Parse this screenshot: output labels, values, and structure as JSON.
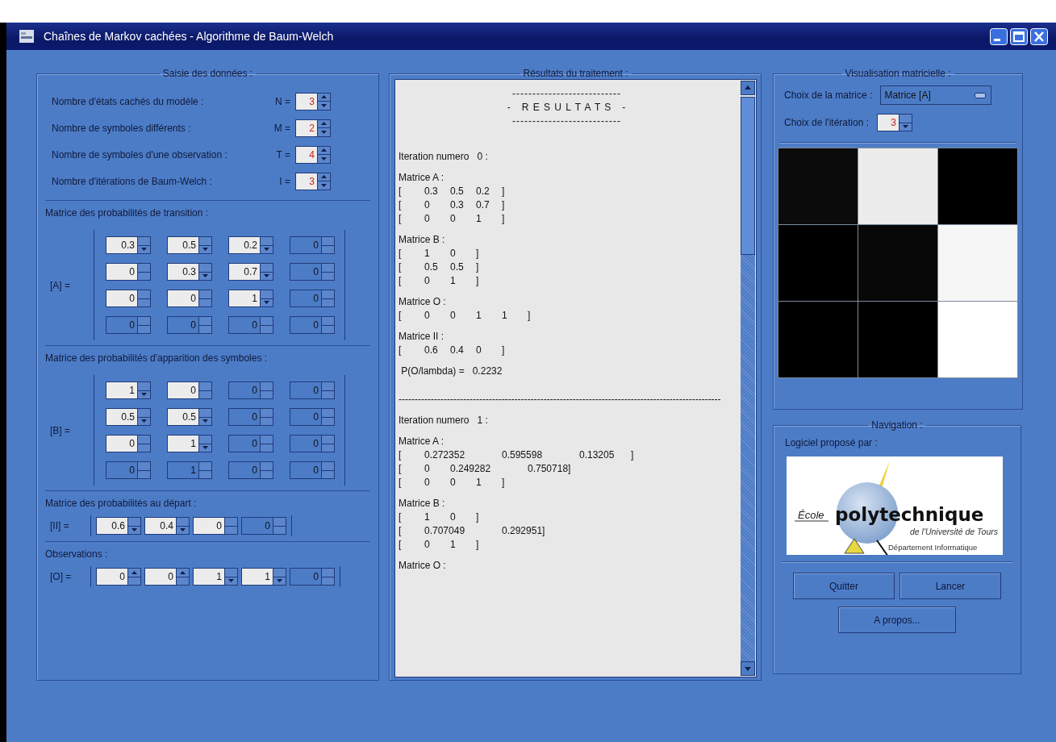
{
  "window": {
    "title": "Chaînes de Markov cachées - Algorithme de Baum-Welch"
  },
  "input_panel": {
    "title": "Saisie des données :",
    "params": [
      {
        "label": "Nombre d'états cachés du modèle :",
        "symbol": "N =",
        "value": "3",
        "disabled": false,
        "up_arrow": true,
        "down_arrow": true
      },
      {
        "label": "Nombre de symboles différents :",
        "symbol": "M =",
        "value": "2",
        "disabled": false,
        "up_arrow": true,
        "down_arrow": true
      },
      {
        "label": "Nombre de symboles d'une observation :",
        "symbol": "T =",
        "value": "4",
        "disabled": false,
        "up_arrow": true,
        "down_arrow": true
      },
      {
        "label": "Nombre d'itérations de Baum-Welch :",
        "symbol": "I =",
        "value": "3",
        "disabled": false,
        "up_arrow": true,
        "down_arrow": true
      }
    ],
    "matrices": [
      {
        "title": "Matrice des probabilités de transition :",
        "symbol": "[A] =",
        "rows": [
          [
            {
              "value": "0.3",
              "disabled": false,
              "up_arrow": false,
              "down_arrow": true
            },
            {
              "value": "0.5",
              "disabled": false,
              "up_arrow": false,
              "down_arrow": true
            },
            {
              "value": "0.2",
              "disabled": false,
              "up_arrow": false,
              "down_arrow": true
            },
            {
              "value": "0",
              "disabled": true,
              "up_arrow": false,
              "down_arrow": false
            }
          ],
          [
            {
              "value": "0",
              "disabled": false,
              "up_arrow": false,
              "down_arrow": false
            },
            {
              "value": "0.3",
              "disabled": false,
              "up_arrow": false,
              "down_arrow": true
            },
            {
              "value": "0.7",
              "disabled": false,
              "up_arrow": false,
              "down_arrow": true
            },
            {
              "value": "0",
              "disabled": true,
              "up_arrow": false,
              "down_arrow": false
            }
          ],
          [
            {
              "value": "0",
              "disabled": false,
              "up_arrow": false,
              "down_arrow": false
            },
            {
              "value": "0",
              "disabled": false,
              "up_arrow": false,
              "down_arrow": false
            },
            {
              "value": "1",
              "disabled": false,
              "up_arrow": false,
              "down_arrow": true
            },
            {
              "value": "0",
              "disabled": true,
              "up_arrow": false,
              "down_arrow": false
            }
          ],
          [
            {
              "value": "0",
              "disabled": true,
              "up_arrow": false,
              "down_arrow": false
            },
            {
              "value": "0",
              "disabled": true,
              "up_arrow": false,
              "down_arrow": false
            },
            {
              "value": "0",
              "disabled": true,
              "up_arrow": false,
              "down_arrow": false
            },
            {
              "value": "0",
              "disabled": true,
              "up_arrow": false,
              "down_arrow": false
            }
          ]
        ]
      },
      {
        "title": "Matrice des probabilités d'apparition des symboles :",
        "symbol": "[B] =",
        "rows": [
          [
            {
              "value": "1",
              "disabled": false,
              "up_arrow": false,
              "down_arrow": true
            },
            {
              "value": "0",
              "disabled": false,
              "up_arrow": false,
              "down_arrow": false
            },
            {
              "value": "0",
              "disabled": true,
              "up_arrow": false,
              "down_arrow": false
            },
            {
              "value": "0",
              "disabled": true,
              "up_arrow": false,
              "down_arrow": false
            }
          ],
          [
            {
              "value": "0.5",
              "disabled": false,
              "up_arrow": false,
              "down_arrow": true
            },
            {
              "value": "0.5",
              "disabled": false,
              "up_arrow": false,
              "down_arrow": true
            },
            {
              "value": "0",
              "disabled": true,
              "up_arrow": false,
              "down_arrow": false
            },
            {
              "value": "0",
              "disabled": true,
              "up_arrow": false,
              "down_arrow": false
            }
          ],
          [
            {
              "value": "0",
              "disabled": false,
              "up_arrow": false,
              "down_arrow": false
            },
            {
              "value": "1",
              "disabled": false,
              "up_arrow": false,
              "down_arrow": true
            },
            {
              "value": "0",
              "disabled": true,
              "up_arrow": false,
              "down_arrow": false
            },
            {
              "value": "0",
              "disabled": true,
              "up_arrow": false,
              "down_arrow": false
            }
          ],
          [
            {
              "value": "0",
              "disabled": true,
              "up_arrow": false,
              "down_arrow": false
            },
            {
              "value": "1",
              "disabled": true,
              "up_arrow": false,
              "down_arrow": false
            },
            {
              "value": "0",
              "disabled": true,
              "up_arrow": false,
              "down_arrow": false
            },
            {
              "value": "0",
              "disabled": true,
              "up_arrow": false,
              "down_arrow": false
            }
          ]
        ]
      },
      {
        "title": "Matrice des probabilités au départ :",
        "symbol": "[II] =",
        "rows": [
          [
            {
              "value": "0.6",
              "disabled": false,
              "up_arrow": false,
              "down_arrow": true
            },
            {
              "value": "0.4",
              "disabled": false,
              "up_arrow": false,
              "down_arrow": true
            },
            {
              "value": "0",
              "disabled": false,
              "up_arrow": false,
              "down_arrow": false
            },
            {
              "value": "0",
              "disabled": true,
              "up_arrow": false,
              "down_arrow": false
            }
          ]
        ]
      },
      {
        "title": "Observations :",
        "symbol": "[O] =",
        "rows": [
          [
            {
              "value": "0",
              "disabled": false,
              "up_arrow": true,
              "down_arrow": false
            },
            {
              "value": "0",
              "disabled": false,
              "up_arrow": true,
              "down_arrow": false
            },
            {
              "value": "1",
              "disabled": false,
              "up_arrow": false,
              "down_arrow": true
            },
            {
              "value": "1",
              "disabled": false,
              "up_arrow": false,
              "down_arrow": true
            },
            {
              "value": "0",
              "disabled": true,
              "up_arrow": false,
              "down_arrow": false
            }
          ]
        ]
      }
    ]
  },
  "results_panel": {
    "title": "Résultats du traitement :",
    "lines": [
      {
        "kind": "gap"
      },
      {
        "kind": "center",
        "text": "---------------------------"
      },
      {
        "kind": "center",
        "text": "-   R E S U L T A T S   -"
      },
      {
        "kind": "center",
        "text": "---------------------------"
      },
      {
        "kind": "gap"
      },
      {
        "kind": "gap"
      },
      {
        "kind": "gap"
      },
      {
        "kind": "text",
        "text": "Iteration numero   0 :"
      },
      {
        "kind": "gap"
      },
      {
        "kind": "text",
        "text": "Matrice A :"
      },
      {
        "kind": "text",
        "text": "[\t0.3\t0.5\t0.2\t]"
      },
      {
        "kind": "text",
        "text": "[\t0\t0.3\t0.7\t]"
      },
      {
        "kind": "text",
        "text": "[\t0\t0\t1\t]"
      },
      {
        "kind": "gap"
      },
      {
        "kind": "text",
        "text": "Matrice B :"
      },
      {
        "kind": "text",
        "text": "[\t1\t0\t]"
      },
      {
        "kind": "text",
        "text": "[\t0.5\t0.5\t]"
      },
      {
        "kind": "text",
        "text": "[\t0\t1\t]"
      },
      {
        "kind": "gap"
      },
      {
        "kind": "text",
        "text": "Matrice O :"
      },
      {
        "kind": "text",
        "text": "[\t0\t0\t1\t1\t]"
      },
      {
        "kind": "gap"
      },
      {
        "kind": "text",
        "text": "Matrice II :"
      },
      {
        "kind": "text",
        "text": "[\t0.6\t0.4\t0\t]"
      },
      {
        "kind": "gap"
      },
      {
        "kind": "text",
        "text": " P(O/lambda) =   0.2232"
      },
      {
        "kind": "gap"
      },
      {
        "kind": "gap"
      },
      {
        "kind": "rule",
        "text": "----------------------------------------------------------------------------------------------------"
      },
      {
        "kind": "gap"
      },
      {
        "kind": "text",
        "text": "Iteration numero   1 :"
      },
      {
        "kind": "gap"
      },
      {
        "kind": "text",
        "text": "Matrice A :"
      },
      {
        "kind": "text",
        "text": "[\t0.272352\t\t0.595598\t\t0.13205\t]"
      },
      {
        "kind": "text",
        "text": "[\t0\t0.249282\t\t0.750718]"
      },
      {
        "kind": "text",
        "text": "[\t0\t0\t1\t]"
      },
      {
        "kind": "gap"
      },
      {
        "kind": "text",
        "text": "Matrice B :"
      },
      {
        "kind": "text",
        "text": "[\t1\t0\t]"
      },
      {
        "kind": "text",
        "text": "[\t0.707049\t\t0.292951]"
      },
      {
        "kind": "text",
        "text": "[\t0\t1\t]"
      },
      {
        "kind": "gap"
      },
      {
        "kind": "text",
        "text": "Matrice O :"
      }
    ]
  },
  "matrix_panel": {
    "title": "Visualisation matricielle :",
    "matrix_label": "Choix de la matrice :",
    "matrix_choice": "Matrice [A]",
    "iteration_label": "Choix de l'itération :",
    "iteration": {
      "value": "3",
      "disabled": false,
      "up_arrow": false,
      "down_arrow": true
    },
    "cells": [
      [
        {
          "color": "#0b0b0b"
        },
        {
          "color": "#ececec"
        },
        {
          "color": "#000000"
        }
      ],
      [
        {
          "color": "#000000"
        },
        {
          "color": "#080808"
        },
        {
          "color": "#f6f6f6"
        }
      ],
      [
        {
          "color": "#000000"
        },
        {
          "color": "#000000"
        },
        {
          "color": "#ffffff"
        }
      ]
    ]
  },
  "navigation_panel": {
    "title": "Navigation :",
    "credit": "Logiciel proposé par :",
    "logo": {
      "prefix": "École",
      "name": "polytechnique",
      "subtitle": "de l'Université de Tours",
      "department": "Département Informatique"
    },
    "buttons": [
      "Quitter",
      "Lancer",
      "A propos..."
    ]
  }
}
